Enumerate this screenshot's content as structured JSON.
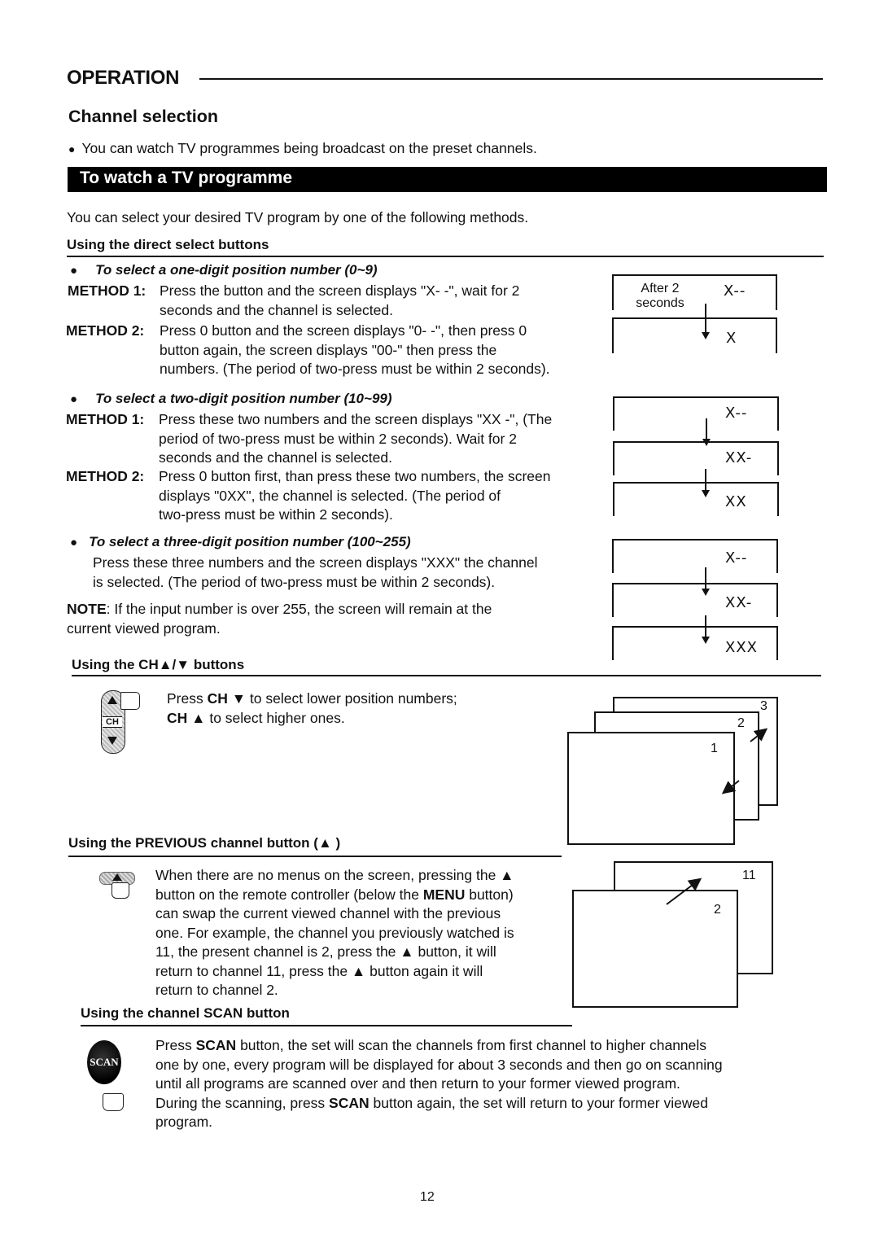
{
  "header": {
    "section_title": "OPERATION",
    "page_title": "Channel selection",
    "intro_bullet": "You can watch TV programmes being broadcast on the preset channels.",
    "banner": "To watch a TV programme",
    "select_intro": "You can select your desired TV program by one of the following methods."
  },
  "direct_select": {
    "heading": "Using the direct select buttons",
    "one_digit": {
      "heading": "To select a one-digit position number (0~9)",
      "method1_label": "METHOD 1:",
      "method1_lines": [
        "Press the button and the screen displays \"X- -\", wait for 2",
        "seconds and the channel is selected."
      ],
      "method2_label": "METHOD 2:",
      "method2_lines": [
        "Press 0 button and the screen displays \"0- -\", then press 0",
        "button again, the screen displays \"00-\" then press the",
        "numbers. (The period of two-press must be within 2 seconds)."
      ],
      "diagram": {
        "caption_line1": "After 2",
        "caption_line2": "seconds",
        "displays": [
          "X--",
          "X"
        ]
      }
    },
    "two_digit": {
      "heading": "To select a two-digit position number (10~99)",
      "method1_label": "METHOD 1:",
      "method1_lines": [
        "Press these two numbers and the screen displays \"XX -\", (The",
        "period of two-press must be within 2 seconds). Wait for 2",
        "seconds and the channel is selected."
      ],
      "method2_label": "METHOD 2:",
      "method2_lines": [
        "Press 0 button first, than press these two numbers, the screen",
        "displays \"0XX\", the channel is selected. (The period of",
        "two-press must be within 2 seconds)."
      ],
      "diagram": {
        "displays": [
          "X--",
          "XX-",
          "XX"
        ]
      }
    },
    "three_digit": {
      "heading": "To select a three-digit position number (100~255)",
      "lines": [
        "Press these three numbers and the screen displays \"XXX\" the channel",
        "is selected. (The period of two-press must be within 2 seconds)."
      ],
      "diagram": {
        "displays": [
          "X--",
          "XX-",
          "XXX"
        ]
      }
    },
    "note_label": "NOTE",
    "note_line1": ": If the input number is over 255, the screen will remain at the",
    "note_line2": "current viewed program."
  },
  "ch_buttons": {
    "heading_prefix": "Using the CH",
    "heading_symbols": "▲/▼",
    "heading_suffix": " buttons",
    "line1_pre": "Press ",
    "line1_bold": "CH ▼",
    "line1_post": " to select lower position numbers;",
    "line2_bold": "CH ▲",
    "line2_post": " to select higher ones.",
    "icon_label": "CH",
    "diagram": {
      "screens": [
        "1",
        "2",
        "3"
      ]
    }
  },
  "previous": {
    "heading": "Using the PREVIOUS channel button (▲ )",
    "lines": [
      "When there are no menus on the screen, pressing the ▲",
      "button on the remote controller (below the |MENU| button)",
      "can swap the  current viewed channel with the previous",
      "one. For example, the channel you previously watched is",
      "11, the present channel is 2, press the  ▲ button, it will",
      "return to channel 11, press the ▲ button again it will",
      "return to channel 2."
    ],
    "line2_pre": "button on the remote controller (below the ",
    "line2_bold": "MENU",
    "line2_post": " button)",
    "diagram": {
      "back_screen": "11",
      "front_screen": "2"
    }
  },
  "scan": {
    "heading": "Using the channel SCAN button",
    "icon_label": "SCAN",
    "line1_pre": "Press ",
    "line1_bold": "SCAN",
    "line1_post": " button, the set will scan the channels from first channel to higher channels",
    "line2": "one by one, every program will be displayed for about 3 seconds and then go on scanning",
    "line3": "until all programs are scanned over and then return to  your former viewed program.",
    "line4_pre": "During the scanning, press ",
    "line4_bold": "SCAN",
    "line4_post": " button again, the set will return to your former viewed",
    "line5": "program."
  },
  "footer": {
    "page_number": "12"
  }
}
